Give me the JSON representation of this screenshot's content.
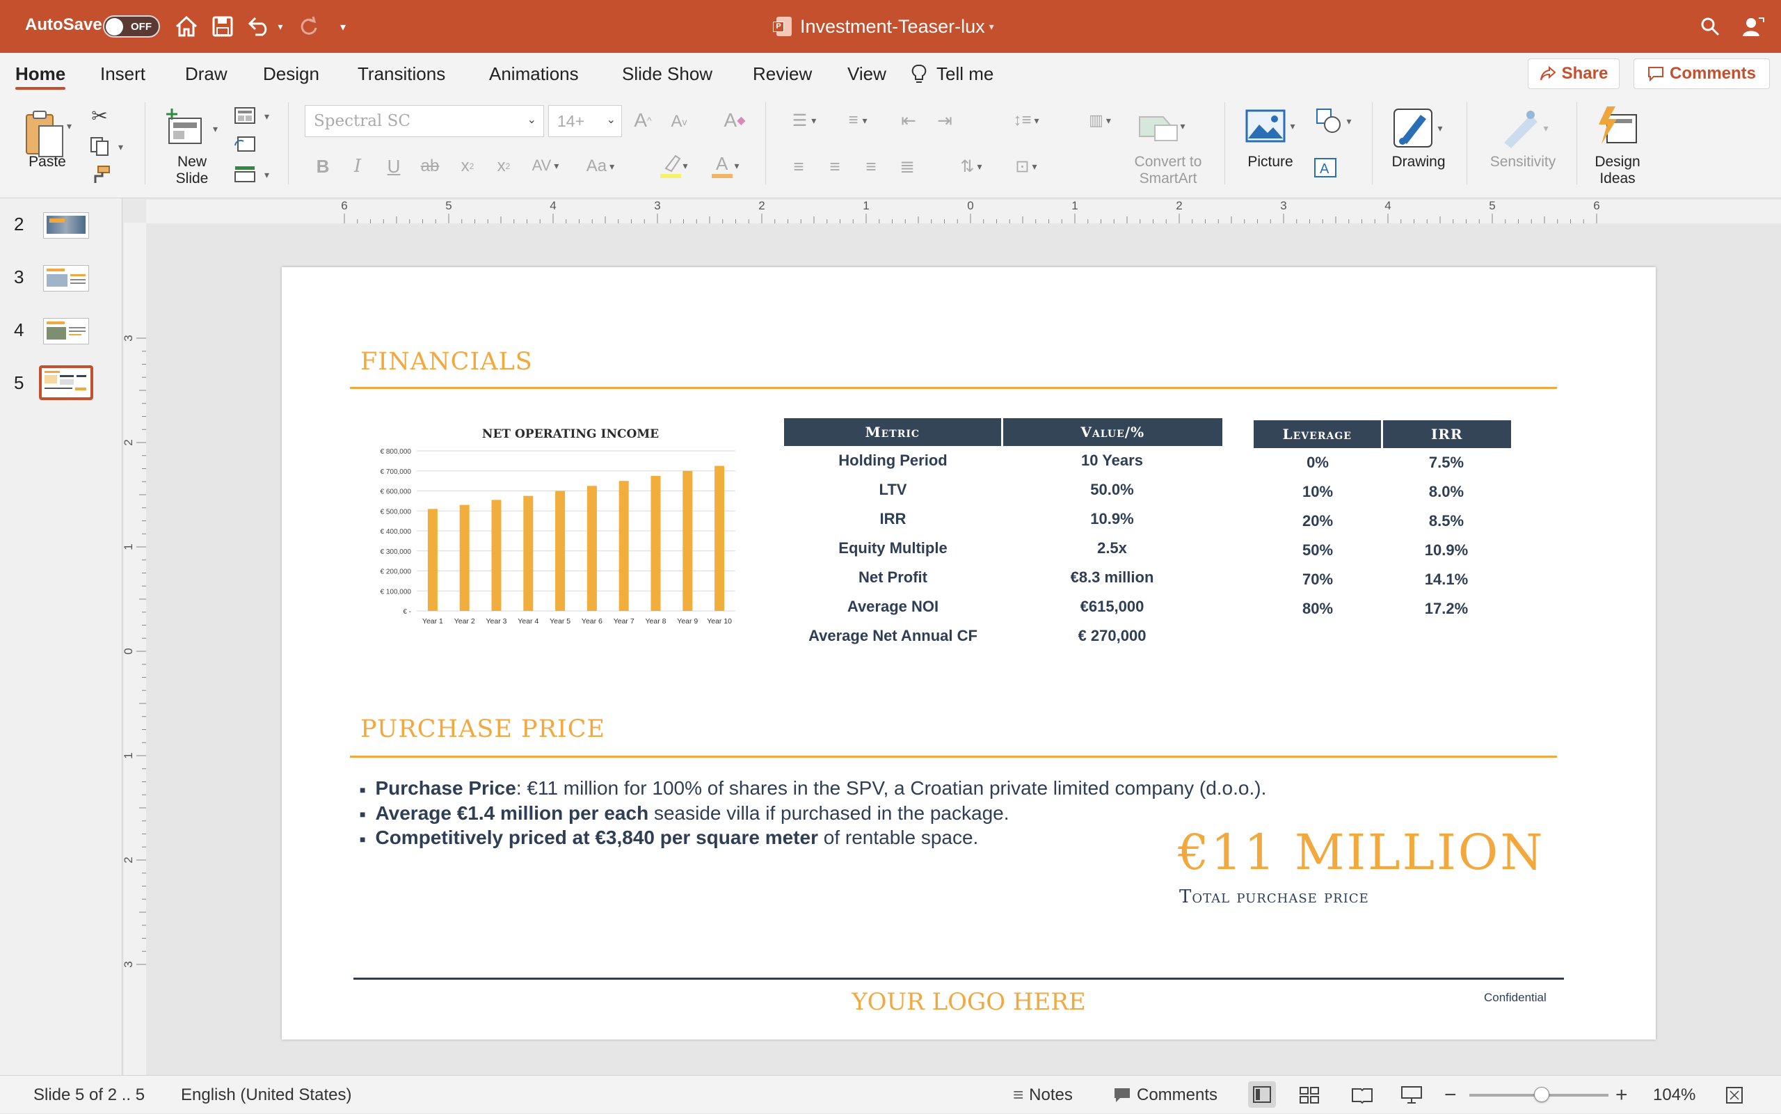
{
  "titlebar": {
    "autosave_label": "AutoSave",
    "autosave_state": "OFF",
    "document_title": "Investment-Teaser-lux",
    "accent": "#c4502e"
  },
  "tabs": [
    "Home",
    "Insert",
    "Draw",
    "Design",
    "Transitions",
    "Animations",
    "Slide Show",
    "Review",
    "View"
  ],
  "tell_me": "Tell me",
  "share_label": "Share",
  "comments_label": "Comments",
  "ribbon": {
    "paste": "Paste",
    "new_slide": "New\nSlide",
    "font_name": "Spectral SC",
    "font_size": "14+",
    "convert_smartart": "Convert to\nSmartArt",
    "picture": "Picture",
    "drawing": "Drawing",
    "sensitivity": "Sensitivity",
    "design_ideas": "Design\nIdeas"
  },
  "thumbnails": [
    {
      "number": "2"
    },
    {
      "number": "3"
    },
    {
      "number": "4"
    },
    {
      "number": "5",
      "selected": true
    }
  ],
  "ruler_h_labels": [
    "6",
    "5",
    "4",
    "3",
    "2",
    "1",
    "0",
    "1",
    "2",
    "3",
    "4",
    "5",
    "6"
  ],
  "ruler_v_labels": [
    "3",
    "2",
    "1",
    "0",
    "1",
    "2",
    "3"
  ],
  "slide": {
    "financials_heading": "FINANCIALS",
    "purchase_heading": "PURCHASE PRICE",
    "metrics_table": {
      "headers": [
        "Metric",
        "Value/%"
      ],
      "rows": [
        [
          "Holding Period",
          "10 Years"
        ],
        [
          "LTV",
          "50.0%"
        ],
        [
          "IRR",
          "10.9%"
        ],
        [
          "Equity Multiple",
          "2.5x"
        ],
        [
          "Net Profit",
          "€8.3 million"
        ],
        [
          "Average NOI",
          "€615,000"
        ],
        [
          "Average Net Annual CF",
          "€ 270,000"
        ]
      ]
    },
    "leverage_table": {
      "headers": [
        "Leverage",
        "IRR"
      ],
      "rows": [
        [
          "0%",
          "7.5%"
        ],
        [
          "10%",
          "8.0%"
        ],
        [
          "20%",
          "8.5%"
        ],
        [
          "50%",
          "10.9%"
        ],
        [
          "70%",
          "14.1%"
        ],
        [
          "80%",
          "17.2%"
        ]
      ]
    },
    "bullets": [
      {
        "bold": "Purchase Price",
        "rest": ": €11 million for 100% of shares in the SPV, a Croatian private limited company (d.o.o.)."
      },
      {
        "bold": "Average €1.4 million per each",
        "rest": " seaside villa if purchased in the package."
      },
      {
        "bold": "Competitively priced at €3,840 per square meter",
        "rest": " of rentable space."
      }
    ],
    "big_price": "€11 MILLION",
    "big_price_caption": "Total purchase price",
    "logo_text": "YOUR LOGO HERE",
    "confidential": "Confidential",
    "gold": "#f2a83d",
    "navy": "#2e3e55"
  },
  "chart_data": {
    "type": "bar",
    "title": "NET OPERATING INCOME",
    "categories": [
      "Year 1",
      "Year 2",
      "Year 3",
      "Year 4",
      "Year 5",
      "Year 6",
      "Year 7",
      "Year 8",
      "Year 9",
      "Year 10"
    ],
    "values": [
      510000,
      530000,
      555000,
      575000,
      600000,
      625000,
      650000,
      675000,
      700000,
      725000
    ],
    "y_ticks": [
      "€ -",
      "€ 100,000",
      "€ 200,000",
      "€ 300,000",
      "€ 400,000",
      "€ 500,000",
      "€ 600,000",
      "€ 700,000",
      "€ 800,000"
    ],
    "ylim": [
      0,
      800000
    ],
    "grid": true,
    "bar_color": "#f2ae3c"
  },
  "statusbar": {
    "slide_info": "Slide 5 of 2 .. 5",
    "language": "English (United States)",
    "notes": "Notes",
    "comments": "Comments",
    "zoom": "104%",
    "zoom_level": 0.52
  }
}
